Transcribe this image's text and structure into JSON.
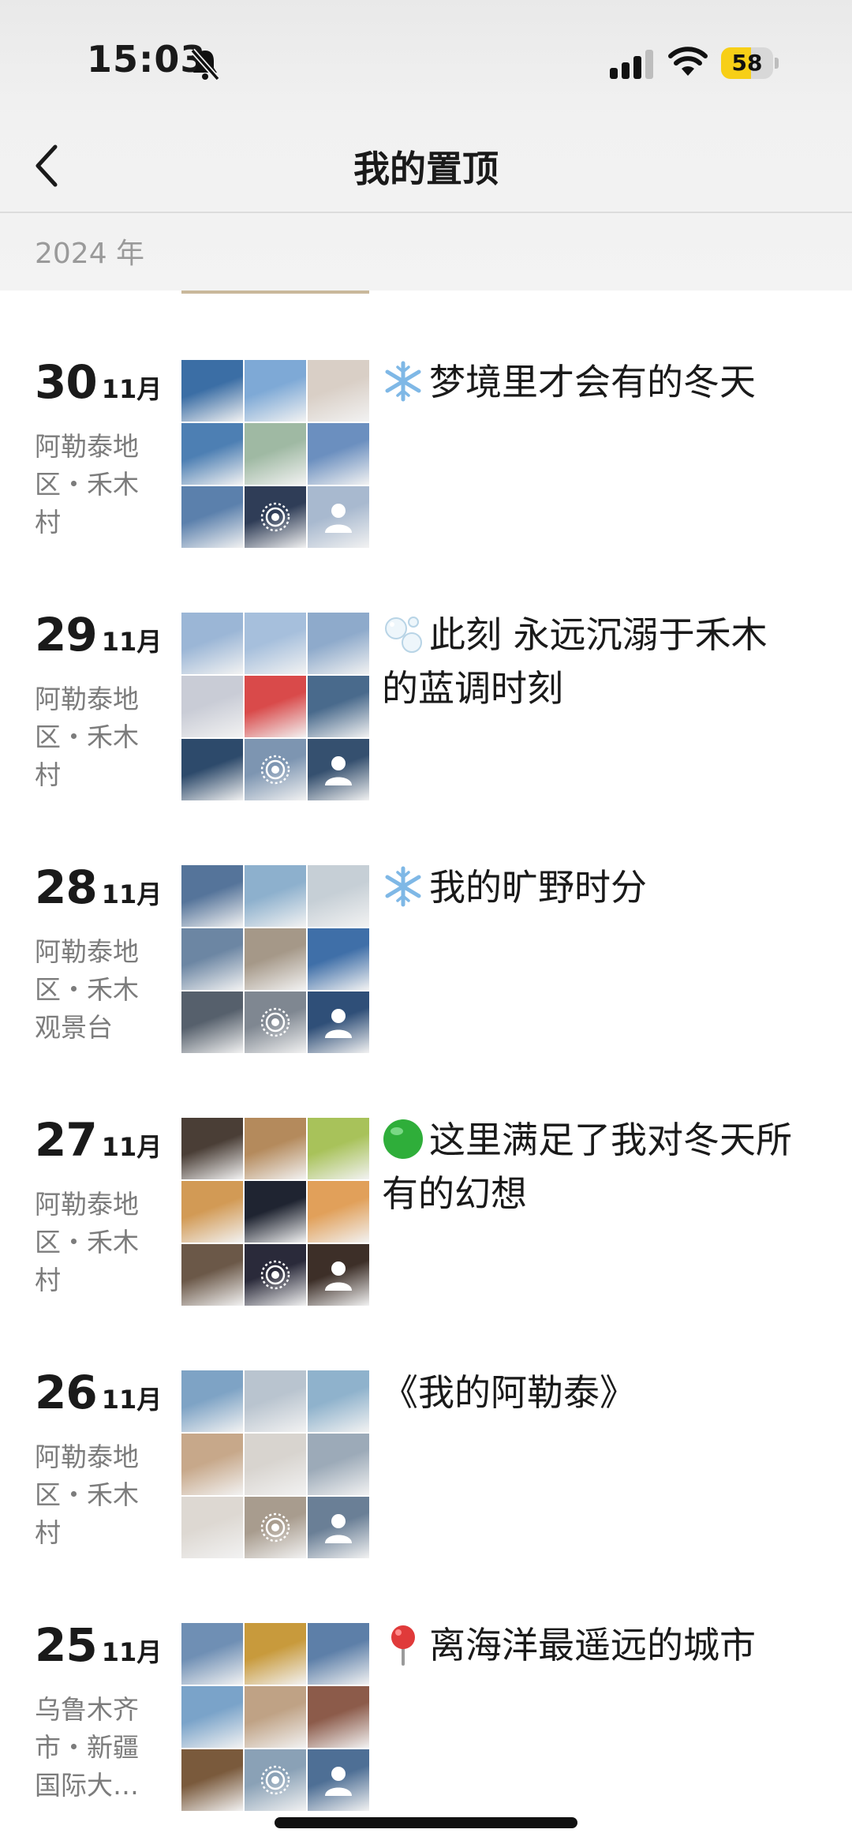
{
  "status_bar": {
    "time": "15:03",
    "battery": "58",
    "battery_level": 0.58
  },
  "nav": {
    "title": "我的置顶"
  },
  "section": {
    "year": "2024 年"
  },
  "posts": [
    {
      "day": "30",
      "month": "11月",
      "location": "阿勒泰地区・禾木村",
      "caption": "梦境里才会有的冬天",
      "emoji": "snowflake-icon",
      "tiles": [
        "#3b6ea5",
        "#7ea9d6",
        "#d9cfc6",
        "#4d7fb3",
        "#9fb9a3",
        "#6b8fbf",
        "#5b80ac",
        "#2f3d57",
        "#a8b9cf"
      ]
    },
    {
      "day": "29",
      "month": "11月",
      "location": "阿勒泰地区・禾木村",
      "caption": "此刻 永远沉溺于禾木的蓝调时刻",
      "emoji": "bubbles-icon",
      "tiles": [
        "#9bb6d6",
        "#a6bfdc",
        "#8eaacb",
        "#c9ccd6",
        "#d94a4a",
        "#496a8c",
        "#2d4a6b",
        "#7d95b1",
        "#35506f"
      ]
    },
    {
      "day": "28",
      "month": "11月",
      "location": "阿勒泰地区・禾木观景台",
      "caption": "我的旷野时分",
      "emoji": "snowflake-icon",
      "tiles": [
        "#55749a",
        "#8db0cd",
        "#c6cfd6",
        "#6c86a3",
        "#a59888",
        "#3f6fa8",
        "#56606c",
        "#7f8791",
        "#2f4f78"
      ]
    },
    {
      "day": "27",
      "month": "11月",
      "location": "阿勒泰地区・禾木村",
      "caption": "这里满足了我对冬天所有的幻想",
      "emoji": "green-circle-icon",
      "tiles": [
        "#4a3e36",
        "#b48a5c",
        "#a8c25a",
        "#d29a55",
        "#1f2431",
        "#e1a05a",
        "#6b5848",
        "#2a2a3a",
        "#3d2f28"
      ]
    },
    {
      "day": "26",
      "month": "11月",
      "location": "阿勒泰地区・禾木村",
      "caption": "《我的阿勒泰》",
      "emoji": "",
      "tiles": [
        "#7ea3c5",
        "#b9c4cf",
        "#8fb2cc",
        "#c7a88a",
        "#d8d4cf",
        "#9caab8",
        "#ddd8d2",
        "#a89c8e",
        "#6a7f96"
      ]
    },
    {
      "day": "25",
      "month": "11月",
      "location": "乌鲁木齐市・新疆国际大…",
      "caption": "离海洋最遥远的城市",
      "emoji": "pin-icon",
      "tiles": [
        "#6f8fb4",
        "#c89a3c",
        "#5d7fa8",
        "#7aa3c9",
        "#bfa285",
        "#8c5b4a",
        "#7a5a3c",
        "#8aa1b6",
        "#4e6f95"
      ]
    }
  ]
}
